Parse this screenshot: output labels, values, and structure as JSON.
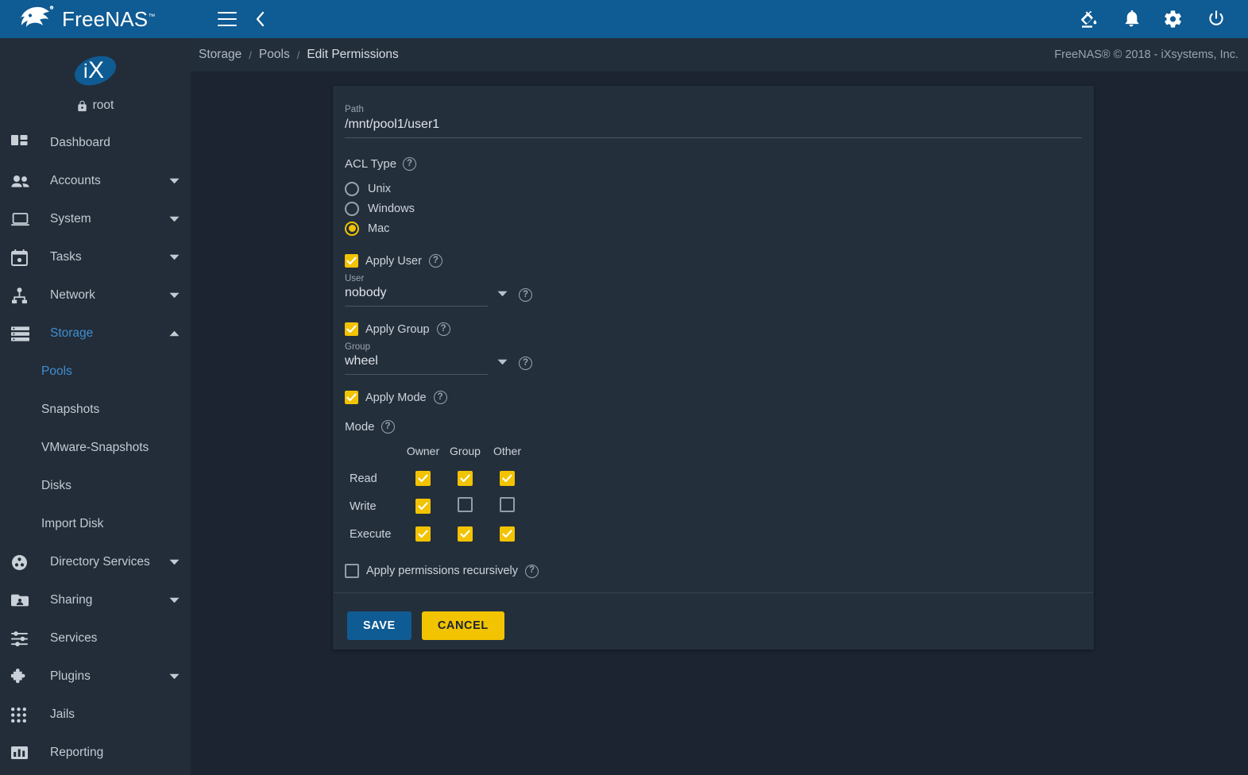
{
  "app": {
    "brand_name": "FreeNAS",
    "brand_tm": "™",
    "copyright": "FreeNAS® © 2018 - iXsystems, Inc."
  },
  "topbar": {
    "menu_toggle_icon": "hamburger-icon",
    "collapse_icon": "chevron-left-icon",
    "actions": [
      {
        "name": "theme-icon",
        "label": "Change Theme"
      },
      {
        "name": "bell-icon",
        "label": "Notifications"
      },
      {
        "name": "gear-icon",
        "label": "Settings"
      },
      {
        "name": "power-icon",
        "label": "Power"
      }
    ]
  },
  "breadcrumb": {
    "items": [
      {
        "label": "Storage",
        "current": false
      },
      {
        "label": "Pools",
        "current": false
      },
      {
        "label": "Edit Permissions",
        "current": true
      }
    ],
    "separator": "/"
  },
  "sidebar": {
    "logo_text": "iX",
    "user": {
      "label": "root",
      "icon": "lock-icon"
    },
    "items": [
      {
        "label": "Dashboard",
        "icon": "dashboard-icon",
        "expandable": false,
        "active": false
      },
      {
        "label": "Accounts",
        "icon": "accounts-icon",
        "expandable": true,
        "active": false
      },
      {
        "label": "System",
        "icon": "system-icon",
        "expandable": true,
        "active": false
      },
      {
        "label": "Tasks",
        "icon": "tasks-calendar-icon",
        "expandable": true,
        "active": false
      },
      {
        "label": "Network",
        "icon": "network-icon",
        "expandable": true,
        "active": false
      },
      {
        "label": "Storage",
        "icon": "storage-icon",
        "expandable": true,
        "active": true,
        "expanded": true,
        "children": [
          {
            "label": "Pools",
            "active": true
          },
          {
            "label": "Snapshots",
            "active": false
          },
          {
            "label": "VMware-Snapshots",
            "active": false
          },
          {
            "label": "Disks",
            "active": false
          },
          {
            "label": "Import Disk",
            "active": false
          }
        ]
      },
      {
        "label": "Directory Services",
        "icon": "directory-services-icon",
        "expandable": true,
        "active": false
      },
      {
        "label": "Sharing",
        "icon": "sharing-folder-icon",
        "expandable": true,
        "active": false
      },
      {
        "label": "Services",
        "icon": "services-sliders-icon",
        "expandable": false,
        "active": false
      },
      {
        "label": "Plugins",
        "icon": "plugins-puzzle-icon",
        "expandable": true,
        "active": false
      },
      {
        "label": "Jails",
        "icon": "jails-grid-icon",
        "expandable": false,
        "active": false
      },
      {
        "label": "Reporting",
        "icon": "reporting-chart-icon",
        "expandable": false,
        "active": false
      }
    ]
  },
  "form": {
    "path": {
      "label": "Path",
      "value": "/mnt/pool1/user1"
    },
    "acl_type": {
      "label": "ACL Type",
      "help": "?",
      "options": [
        {
          "label": "Unix",
          "selected": false
        },
        {
          "label": "Windows",
          "selected": false
        },
        {
          "label": "Mac",
          "selected": true
        }
      ]
    },
    "apply_user": {
      "label": "Apply User",
      "checked": true,
      "help": "?"
    },
    "user": {
      "label": "User",
      "value": "nobody",
      "help": "?"
    },
    "apply_group": {
      "label": "Apply Group",
      "checked": true,
      "help": "?"
    },
    "group": {
      "label": "Group",
      "value": "wheel",
      "help": "?"
    },
    "apply_mode": {
      "label": "Apply Mode",
      "checked": true,
      "help": "?"
    },
    "mode": {
      "label": "Mode",
      "help": "?",
      "columns": [
        "Owner",
        "Group",
        "Other"
      ],
      "rows": [
        {
          "label": "Read",
          "values": [
            true,
            true,
            true
          ]
        },
        {
          "label": "Write",
          "values": [
            true,
            false,
            false
          ]
        },
        {
          "label": "Execute",
          "values": [
            true,
            true,
            true
          ]
        }
      ]
    },
    "recursive": {
      "label": "Apply permissions recursively",
      "checked": false,
      "help": "?"
    },
    "actions": {
      "save_label": "SAVE",
      "cancel_label": "CANCEL"
    }
  },
  "colors": {
    "topbar_blue": "#0f5b93",
    "sidebar_bg": "#222d39",
    "page_bg": "#1b2430",
    "card_bg": "#242f3c",
    "accent_yellow": "#f2c300",
    "accent_blue": "#3f8ed0",
    "text_primary": "#dfe4e9",
    "text_secondary": "#9ba5b0"
  }
}
